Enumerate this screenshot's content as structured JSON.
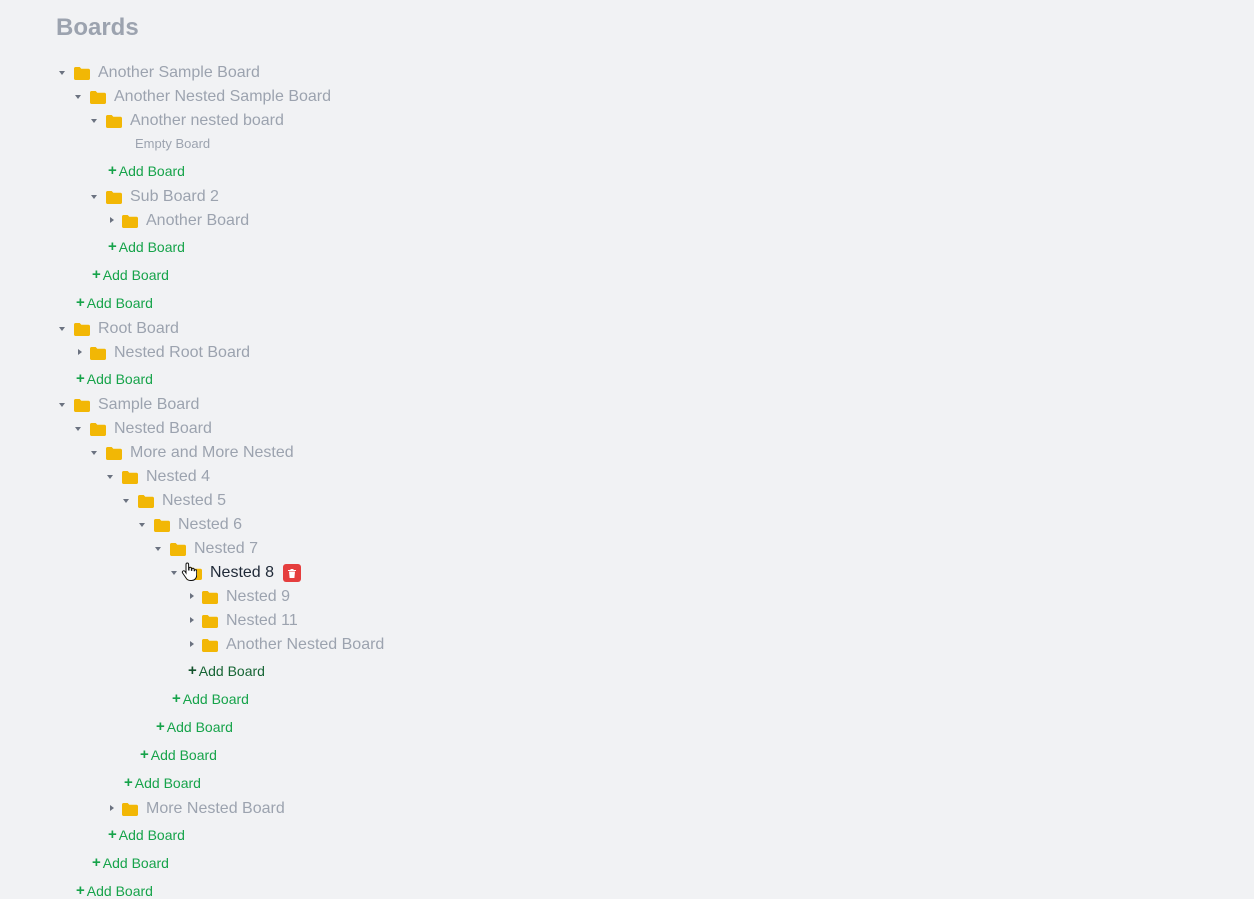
{
  "page_title": "Boards",
  "empty_label": "Empty Board",
  "add_label": "Add Board",
  "add_plus": "+",
  "colors": {
    "folder": "#f2b705",
    "add": "#16a34a",
    "delete": "#e53e3e",
    "muted_text": "#9ca3af"
  },
  "icons": {
    "expanded": "caret-down-icon",
    "collapsed": "caret-right-icon",
    "folder": "folder-icon",
    "delete": "trash-icon",
    "pointer": "hand-pointer-icon"
  },
  "boards": [
    {
      "name": "Another Sample Board",
      "expanded": true,
      "children": [
        {
          "name": "Another Nested Sample Board",
          "expanded": true,
          "children": [
            {
              "name": "Another nested board",
              "expanded": true,
              "empty": true,
              "children": []
            },
            {
              "name": "Sub Board 2",
              "expanded": true,
              "children": [
                {
                  "name": "Another Board",
                  "expanded": false
                }
              ]
            }
          ]
        }
      ]
    },
    {
      "name": "Root Board",
      "expanded": true,
      "children": [
        {
          "name": "Nested Root Board",
          "expanded": false
        }
      ]
    },
    {
      "name": "Sample Board",
      "expanded": true,
      "children": [
        {
          "name": "Nested Board",
          "expanded": true,
          "children": [
            {
              "name": "More and More Nested",
              "expanded": true,
              "children": [
                {
                  "name": "Nested 4",
                  "expanded": true,
                  "children": [
                    {
                      "name": "Nested 5",
                      "expanded": true,
                      "children": [
                        {
                          "name": "Nested 6",
                          "expanded": true,
                          "children": [
                            {
                              "name": "Nested 7",
                              "expanded": true,
                              "children": [
                                {
                                  "name": "Nested 8",
                                  "expanded": true,
                                  "active": true,
                                  "children": [
                                    {
                                      "name": "Nested 9",
                                      "expanded": false
                                    },
                                    {
                                      "name": "Nested 11",
                                      "expanded": false
                                    },
                                    {
                                      "name": "Another Nested Board",
                                      "expanded": false
                                    }
                                  ]
                                }
                              ]
                            }
                          ]
                        }
                      ]
                    }
                  ]
                },
                {
                  "name": "More Nested Board",
                  "expanded": false
                }
              ]
            }
          ]
        }
      ]
    }
  ]
}
